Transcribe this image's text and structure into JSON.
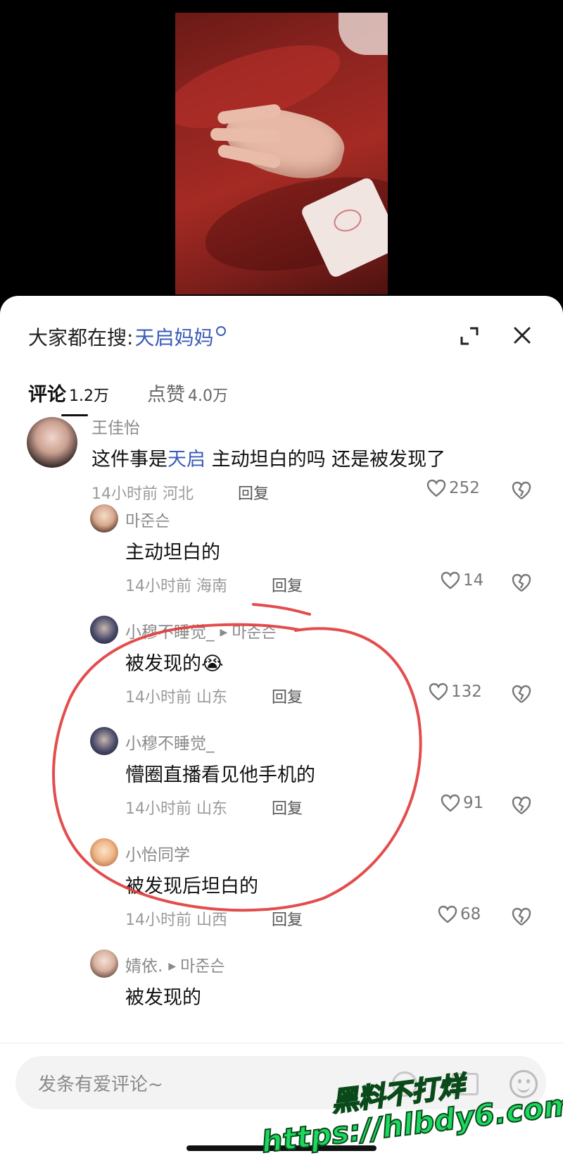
{
  "search": {
    "prefix": "大家都在搜:",
    "keyword": "天启妈妈"
  },
  "tabs": [
    {
      "label": "评论",
      "count": "1.2万"
    },
    {
      "label": "点赞",
      "count": "4.0万"
    }
  ],
  "comments": [
    {
      "user": "王佳怡",
      "text_before": "这件事是",
      "keyword": "天启",
      "text_after": " 主动坦白的吗 还是被发现了",
      "time": "14小时前",
      "location": "河北",
      "reply": "回复",
      "likes": "252"
    },
    {
      "user": "마준슨",
      "text": "主动坦白的",
      "time": "14小时前",
      "location": "海南",
      "reply": "回复",
      "likes": "14"
    },
    {
      "user": "小穆不睡觉_",
      "reply_to": "마준슨",
      "text": "被发现的😭",
      "time": "14小时前",
      "location": "山东",
      "reply": "回复",
      "likes": "132"
    },
    {
      "user": "小穆不睡觉_",
      "text": "懵圈直播看见他手机的",
      "time": "14小时前",
      "location": "山东",
      "reply": "回复",
      "likes": "91"
    },
    {
      "user": "小怡同学",
      "text": "被发现后坦白的",
      "time": "14小时前",
      "location": "山西",
      "reply": "回复",
      "likes": "68"
    },
    {
      "user": "婧依.",
      "reply_to": "마준슨",
      "text": "被发现的"
    }
  ],
  "input": {
    "placeholder": "发条有爱评论~"
  },
  "watermark": {
    "line1": "黑料不打烊",
    "line2": "https://hlbdy6.com"
  },
  "colors": {
    "accent": "#3a5bb8",
    "annotation": "#e03a3a",
    "watermark": "#1ed760"
  }
}
